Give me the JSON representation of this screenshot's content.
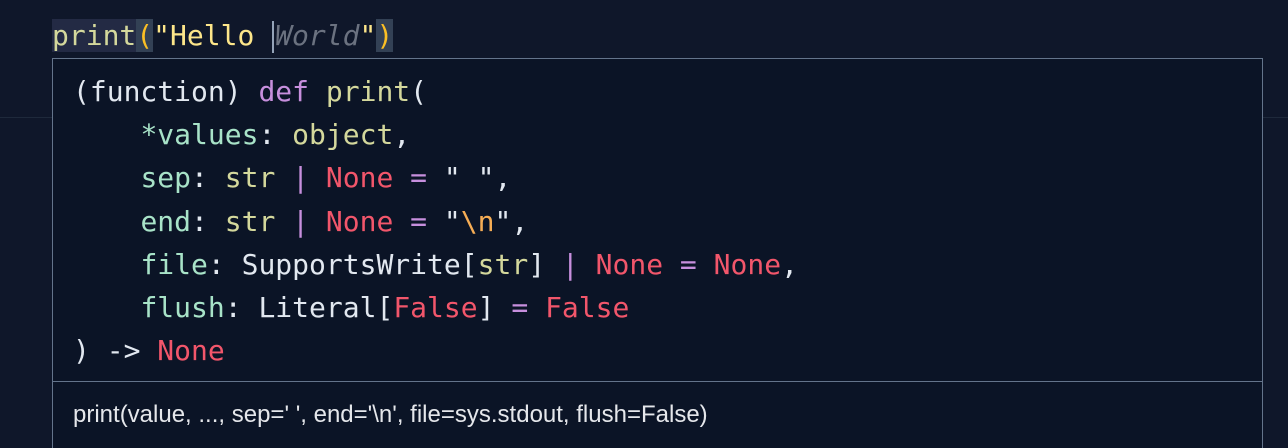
{
  "editor": {
    "function_name": "print",
    "open_paren": "(",
    "string_quote_open": "\"",
    "string_text": "Hello ",
    "ghost_text": "World",
    "string_quote_close": "\"",
    "close_paren": ")"
  },
  "hover": {
    "signature": {
      "prefix": "(function) ",
      "def_keyword": "def",
      "fn_name": "print",
      "open_paren": "(",
      "params": [
        {
          "name": "*values",
          "sep": ": ",
          "type": "object",
          "tail": ","
        },
        {
          "name": "sep",
          "sep": ": ",
          "type": "str",
          "pipe": " | ",
          "none": "None",
          "eq": " = ",
          "default": "\" \"",
          "tail": ","
        },
        {
          "name": "end",
          "sep": ": ",
          "type": "str",
          "pipe": " | ",
          "none": "None",
          "eq": " = ",
          "default_open": "\"",
          "default_escape": "\\n",
          "default_close": "\"",
          "tail": ","
        },
        {
          "name": "file",
          "sep": ": ",
          "type_class": "SupportsWrite",
          "bracket_open": "[",
          "type_arg": "str",
          "bracket_close": "]",
          "pipe": " | ",
          "none": "None",
          "eq": " = ",
          "default": "None",
          "tail": ","
        },
        {
          "name": "flush",
          "sep": ": ",
          "type_class": "Literal",
          "bracket_open": "[",
          "type_arg": "False",
          "bracket_close": "]",
          "eq": " = ",
          "default": "False"
        }
      ],
      "close_paren": ")",
      "arrow": " -> ",
      "return_type": "None"
    },
    "docstring": "print(value, ..., sep=' ', end='\\n', file=sys.stdout, flush=False)"
  },
  "colors": {
    "background": "#0f172a",
    "keyword": "#c78fdd",
    "function": "#d4d89c",
    "parameter": "#a8e3c8",
    "none": "#f2566b",
    "escape": "#f6ad55",
    "border": "#64748b"
  }
}
